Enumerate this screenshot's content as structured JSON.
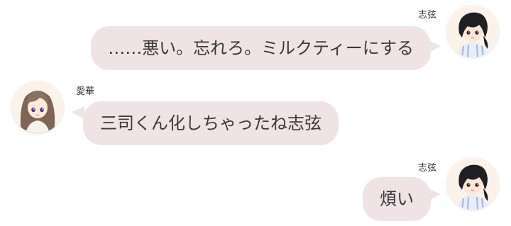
{
  "colors": {
    "bubble": "#f0e3e6",
    "text": "#3a3a3a",
    "name_text": "#333333",
    "avatar_bg": "#fbf3ea"
  },
  "messages": [
    {
      "speaker": "志弦",
      "side": "right",
      "avatar_icon": "shigen-avatar-icon",
      "text": "……悪い。忘れろ。ミルクティーにする"
    },
    {
      "speaker": "愛華",
      "side": "left",
      "avatar_icon": "aika-avatar-icon",
      "text": "三司くん化しちゃったね志弦"
    },
    {
      "speaker": "志弦",
      "side": "right",
      "avatar_icon": "shigen-avatar-icon",
      "text": "煩い"
    }
  ]
}
